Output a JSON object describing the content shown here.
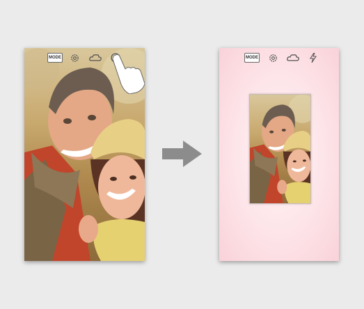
{
  "left_screen": {
    "toolbar": {
      "mode_label": "MODE",
      "icons": [
        "settings-icon",
        "cloud-icon",
        "shutter-target-icon"
      ]
    },
    "gesture": "tap-hand-icon"
  },
  "transition": "right-arrow-icon",
  "right_screen": {
    "toolbar": {
      "mode_label": "MODE",
      "icons": [
        "settings-icon",
        "cloud-icon",
        "flash-icon"
      ]
    },
    "background_color": "#fde4e8"
  },
  "colors": {
    "page_bg": "#ebebeb",
    "arrow": "#8c8c8c",
    "icon_stroke": "#555555"
  }
}
